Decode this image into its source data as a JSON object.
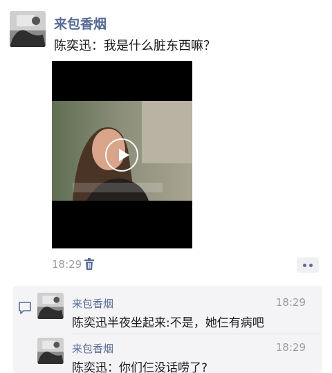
{
  "post": {
    "author": "来包香烟",
    "text": "陈奕迅：我是什么脏东西嘛？",
    "time": "18:29",
    "video": {
      "icon": "play-icon"
    },
    "actions": {
      "delete_icon": "trash-icon",
      "more_icon": "more-dots-icon"
    }
  },
  "comments": {
    "icon": "comment-bubble-icon",
    "items": [
      {
        "name": "来包香烟",
        "time": "18:29",
        "text": "陈奕迅半夜坐起来:不是，她仨有病吧"
      },
      {
        "name": "来包香烟",
        "time": "18:29",
        "text": "陈奕迅：你们仨没话唠了?"
      }
    ]
  },
  "colors": {
    "link": "#576b95",
    "muted": "#9b9b9b",
    "comment_bg": "#f4f4f6"
  }
}
